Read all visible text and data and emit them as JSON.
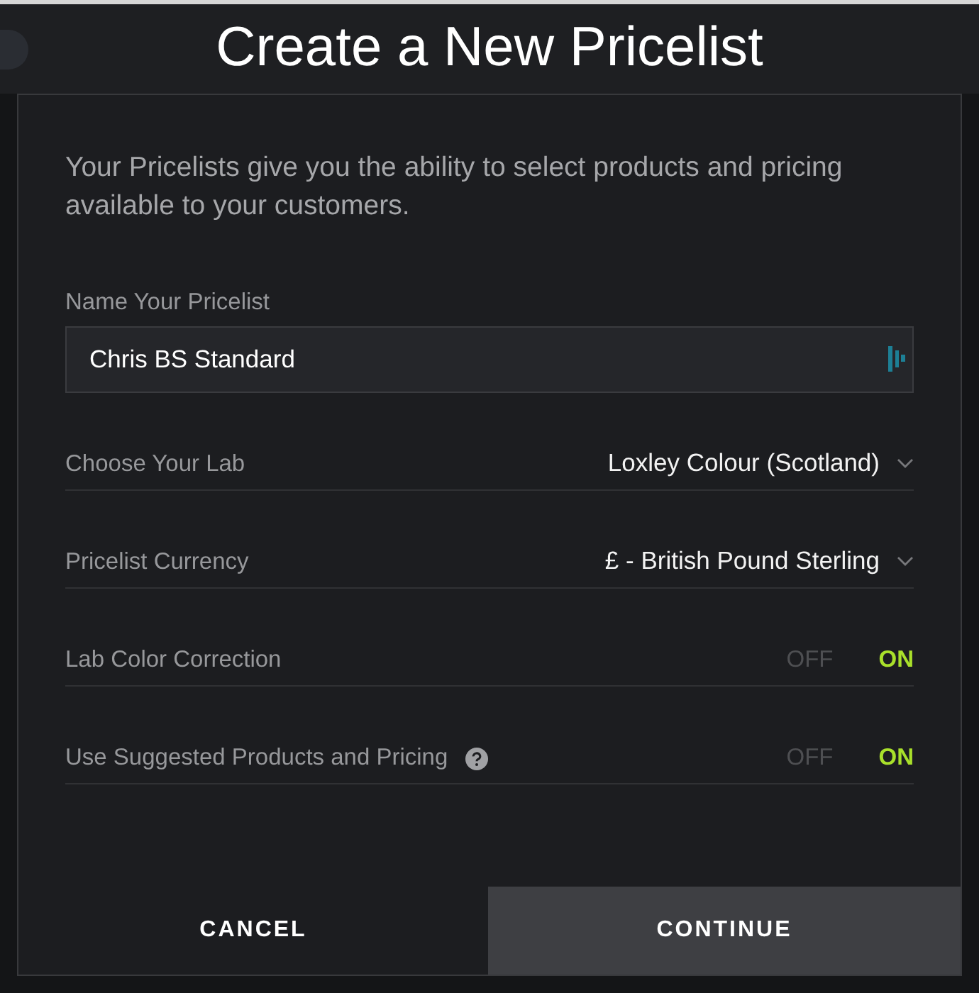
{
  "dialog": {
    "title": "Create a New Pricelist",
    "description": "Your Pricelists give you the ability to select products and pricing available to your customers.",
    "name_field": {
      "label": "Name Your Pricelist",
      "value": "Chris BS Standard"
    },
    "settings": [
      {
        "kind": "select",
        "label": "Choose Your Lab",
        "value": "Loxley Colour (Scotland)"
      },
      {
        "kind": "select",
        "label": "Pricelist Currency",
        "value": "£ - British Pound Sterling"
      },
      {
        "kind": "toggle",
        "label": "Lab Color Correction",
        "help": false,
        "off_label": "OFF",
        "on_label": "ON",
        "on": true
      },
      {
        "kind": "toggle",
        "label": "Use Suggested Products and Pricing",
        "help": true,
        "off_label": "OFF",
        "on_label": "ON",
        "on": true
      }
    ],
    "buttons": [
      {
        "kind": "cancel",
        "label": "CANCEL"
      },
      {
        "kind": "continue",
        "label": "CONTINUE"
      }
    ]
  }
}
